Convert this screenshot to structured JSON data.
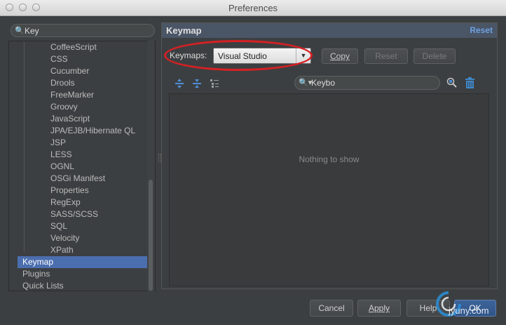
{
  "window": {
    "title": "Preferences"
  },
  "sidebar": {
    "search_value": "Key",
    "sub_items": [
      "CoffeeScript",
      "CSS",
      "Cucumber",
      "Drools",
      "FreeMarker",
      "Groovy",
      "JavaScript",
      "JPA/EJB/Hibernate QL",
      "JSP",
      "LESS",
      "OGNL",
      "OSGi Manifest",
      "Properties",
      "RegExp",
      "SASS/SCSS",
      "SQL",
      "Velocity",
      "XPath"
    ],
    "top_items": [
      {
        "label": "Keymap",
        "selected": true
      },
      {
        "label": "Plugins",
        "selected": false
      },
      {
        "label": "Quick Lists",
        "selected": false
      }
    ]
  },
  "panel": {
    "title": "Keymap",
    "reset_link": "Reset",
    "keymaps_label": "Keymaps:",
    "keymap_selected": "Visual Studio",
    "copy_button": "Copy",
    "reset_button": "Reset",
    "delete_button": "Delete",
    "filter_value": "Keybo",
    "empty_text": "Nothing to show"
  },
  "footer": {
    "cancel": "Cancel",
    "apply": "Apply",
    "help": "Help",
    "ok": "OK"
  },
  "watermark": {
    "text": "jyuny.com"
  },
  "colors": {
    "selection": "#4b6eaf",
    "highlight_ellipse": "#d62024",
    "link": "#6ea0e0",
    "toolbar_icon": "#4f8fd6",
    "trash_icon": "#3d87c9"
  }
}
